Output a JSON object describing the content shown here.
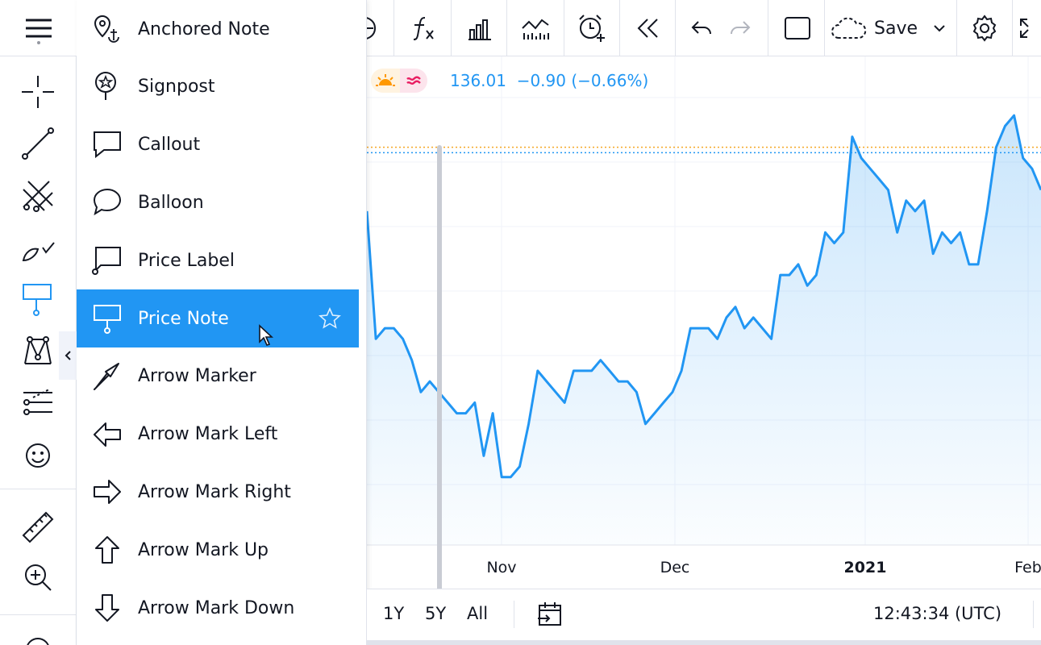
{
  "toolbar": {
    "save_label": "Save"
  },
  "menu": {
    "items": [
      {
        "label": "Anchored Note",
        "icon": "anchored-note-icon"
      },
      {
        "label": "Signpost",
        "icon": "signpost-icon"
      },
      {
        "label": "Callout",
        "icon": "callout-icon"
      },
      {
        "label": "Balloon",
        "icon": "balloon-icon"
      },
      {
        "label": "Price Label",
        "icon": "price-label-icon"
      },
      {
        "label": "Price Note",
        "icon": "price-note-icon"
      },
      {
        "label": "Arrow Marker",
        "icon": "arrow-marker-icon"
      },
      {
        "label": "Arrow Mark Left",
        "icon": "arrow-mark-left-icon"
      },
      {
        "label": "Arrow Mark Right",
        "icon": "arrow-mark-right-icon"
      },
      {
        "label": "Arrow Mark Up",
        "icon": "arrow-mark-up-icon"
      },
      {
        "label": "Arrow Mark Down",
        "icon": "arrow-mark-down-icon"
      }
    ],
    "active_index": 5
  },
  "legend": {
    "price": "136.01",
    "change": "−0.90 (−0.66%)"
  },
  "bottombar": {
    "ranges": [
      "1Y",
      "5Y",
      "All"
    ],
    "clock": "12:43:34 (UTC)"
  },
  "colors": {
    "accent": "#2196f3",
    "area_fill": "#d6e9fb",
    "orange_line": "#f5a623",
    "grid": "#f0f3fa"
  },
  "chart_data": {
    "type": "area",
    "x_tick_labels": [
      "Nov",
      "Dec",
      "2021",
      "Feb"
    ],
    "values": [
      130,
      118,
      119,
      119,
      118,
      116,
      113,
      114,
      113,
      112,
      111,
      111,
      112,
      107,
      111,
      105,
      105,
      106,
      110,
      115,
      114,
      113,
      112,
      115,
      115,
      115,
      116,
      115,
      114,
      114,
      113,
      110,
      111,
      112,
      113,
      115,
      119,
      119,
      119,
      118,
      120,
      121,
      119,
      120,
      119,
      118,
      124,
      124,
      125,
      123,
      124,
      128,
      127,
      128,
      137,
      135,
      134,
      133,
      132,
      128,
      131,
      130,
      131,
      126,
      128,
      127,
      128,
      125,
      125,
      130,
      136,
      138,
      139,
      135,
      134,
      132
    ],
    "last_price": 136.01,
    "price_lines": [
      136.01,
      135.5
    ]
  }
}
